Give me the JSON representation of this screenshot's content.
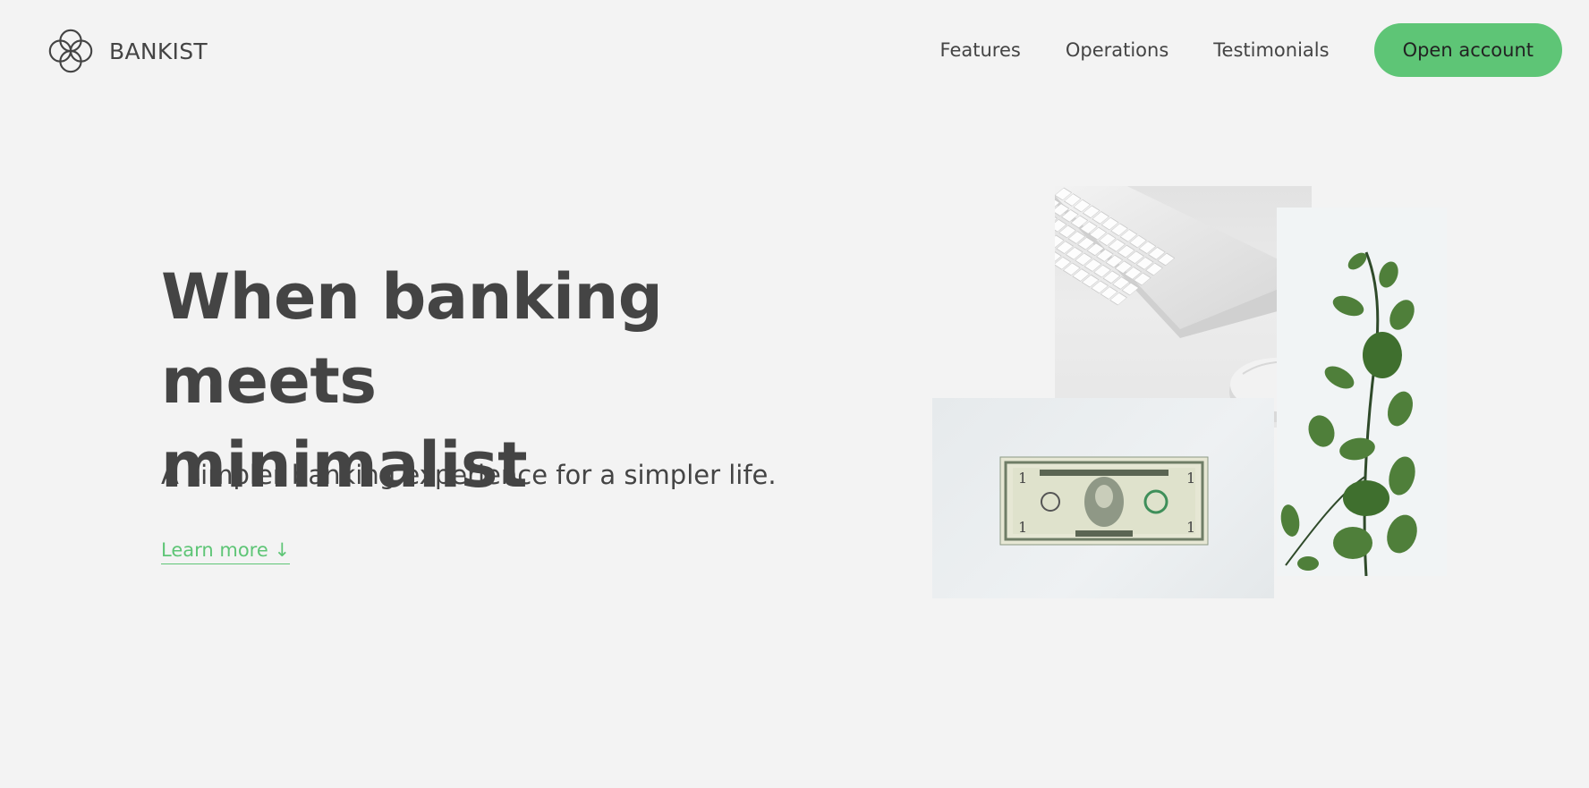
{
  "brand": {
    "name": "BANKIST",
    "logo_icon": "four-circle-knot-icon"
  },
  "nav": {
    "links": [
      "Features",
      "Operations",
      "Testimonials"
    ],
    "cta_label": "Open account",
    "cta_color": "#5ec576"
  },
  "hero": {
    "title_word1": "When",
    "title_highlight1": "banking",
    "title_word2": "meets",
    "title_highlight2": "minimalist",
    "subtitle": "A simpler banking experience for a simpler life.",
    "learn_more": "Learn more ↓"
  },
  "images": {
    "keyboard": "keyboard-mouse-photo",
    "dollar": "one-dollar-bill-photo",
    "plant": "eucalyptus-plant-photo"
  },
  "colors": {
    "background": "#f3f3f3",
    "accent": "#5ec576",
    "text": "#444444"
  }
}
